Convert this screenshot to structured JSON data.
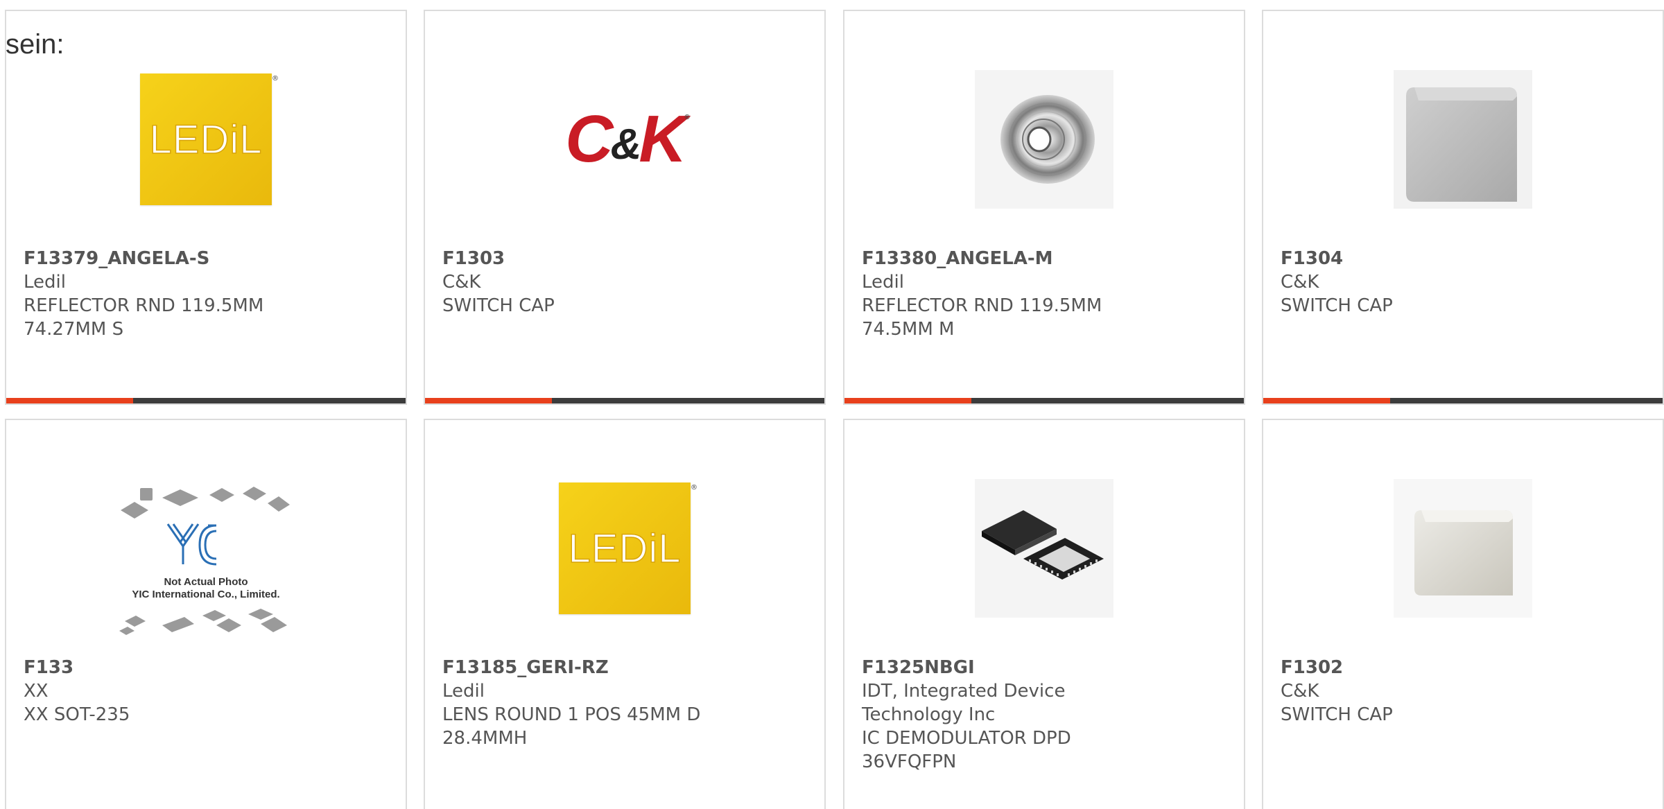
{
  "header_fragment": "sein:",
  "colors": {
    "accent": "#e8401c",
    "bar_dark": "#3c3c3c",
    "ledil_yellow": "#f6d21a",
    "ck_red": "#c91c25"
  },
  "products": [
    {
      "part": "F13379_ANGELA-S",
      "brand": "Ledil",
      "desc1": "REFLECTOR RND 119.5MM",
      "desc2": "74.27MM S",
      "image": "ledil-logo",
      "logo_text": "LEDiL",
      "reg_mark": "®"
    },
    {
      "part": "F1303",
      "brand": "C&K",
      "desc1": "SWITCH CAP",
      "desc2": "",
      "image": "ck-logo",
      "logo_text_a": "C",
      "logo_text_amp": "&",
      "logo_text_b": "K",
      "reg_mark": "®"
    },
    {
      "part": "F13380_ANGELA-M",
      "brand": "Ledil",
      "desc1": "REFLECTOR RND 119.5MM",
      "desc2": "74.5MM M",
      "image": "reflector-photo"
    },
    {
      "part": "F1304",
      "brand": "C&K",
      "desc1": "SWITCH CAP",
      "desc2": "",
      "image": "gray-switch-cap-photo"
    },
    {
      "part": "F133",
      "brand": "XX",
      "desc1": "XX SOT-235",
      "desc2": "",
      "image": "yic-placeholder",
      "note1": "Not Actual Photo",
      "note2": "YIC International Co., Limited."
    },
    {
      "part": "F13185_GERI-RZ",
      "brand": "Ledil",
      "desc1": "LENS ROUND 1 POS 45MM D",
      "desc2": "28.4MMH",
      "image": "ledil-logo",
      "logo_text": "LEDiL",
      "reg_mark": "®"
    },
    {
      "part": "F1325NBGI",
      "brand": "IDT, Integrated Device",
      "brand2": "Technology Inc",
      "desc1": "IC DEMODULATOR DPD",
      "desc2": "36VFQFPN",
      "image": "qfn-ic-photo"
    },
    {
      "part": "F1302",
      "brand": "C&K",
      "desc1": "SWITCH CAP",
      "desc2": "",
      "image": "white-switch-cap-photo"
    }
  ]
}
